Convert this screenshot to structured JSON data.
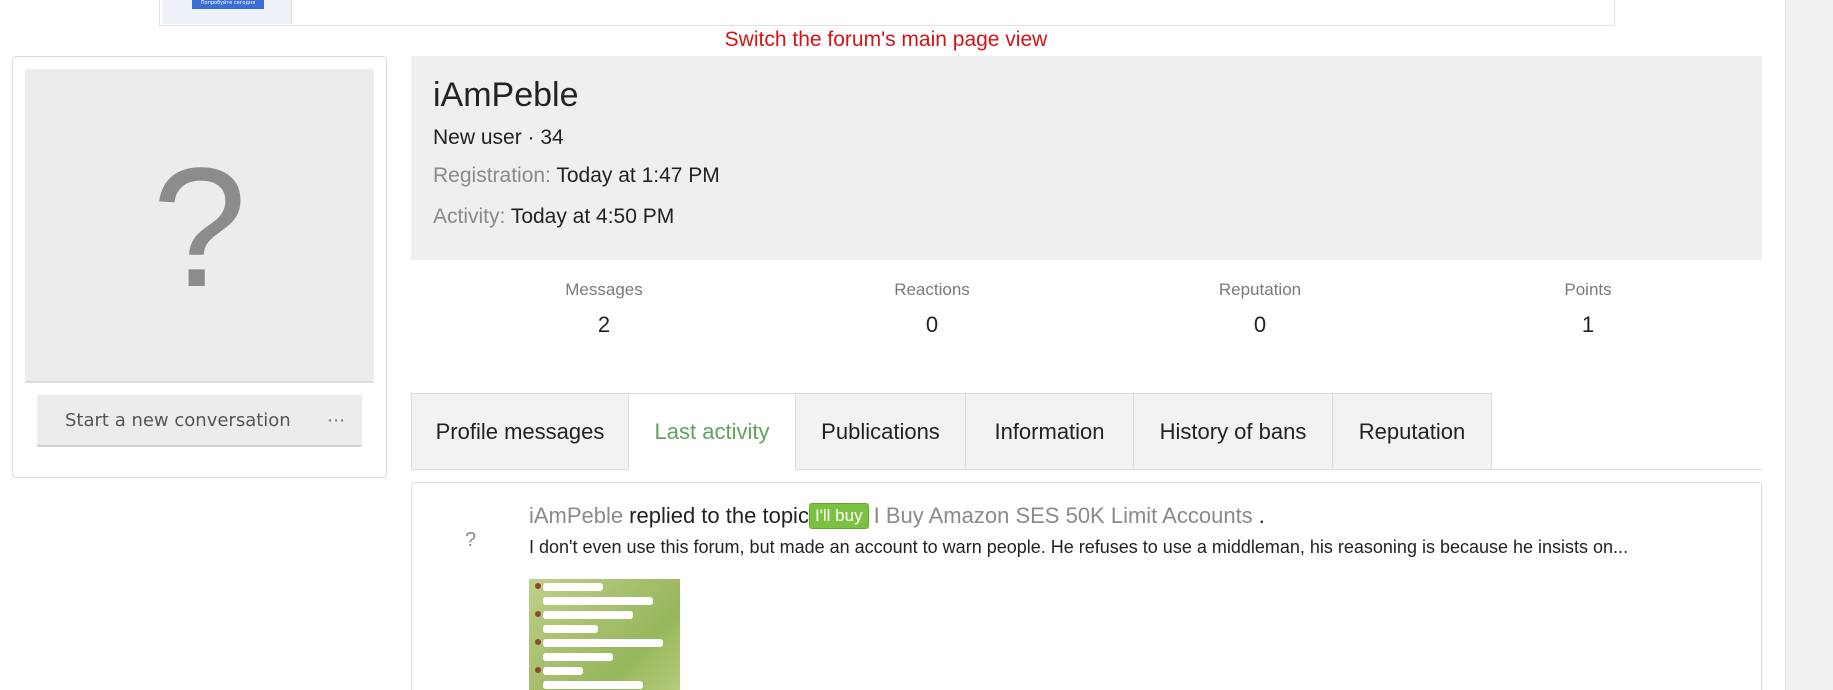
{
  "banner": {
    "ad_button": "Попробуйте сегодня"
  },
  "switch_view": "Switch the forum's main page view",
  "sidebar": {
    "avatar_placeholder": "?",
    "conversation_button": "Start a new conversation",
    "more_button": "⋯"
  },
  "profile": {
    "username": "iAmPeble",
    "user_title": "New user · 34",
    "registration_label": "Registration:",
    "registration_value": "Today at 1:47 PM",
    "activity_label": "Activity:",
    "activity_value": "Today at 4:50 PM"
  },
  "stats": [
    {
      "label": "Messages",
      "value": "2"
    },
    {
      "label": "Reactions",
      "value": "0"
    },
    {
      "label": "Reputation",
      "value": "0"
    },
    {
      "label": "Points",
      "value": "1"
    }
  ],
  "tabs": [
    {
      "label": "Profile messages",
      "active": false
    },
    {
      "label": "Last activity",
      "active": true
    },
    {
      "label": "Publications",
      "active": false
    },
    {
      "label": "Information",
      "active": false
    },
    {
      "label": "History of bans",
      "active": false
    },
    {
      "label": "Reputation",
      "active": false
    }
  ],
  "activity_item": {
    "avatar": "?",
    "user": "iAmPeble",
    "action": "replied to the topic",
    "prefix_badge": "I'll buy",
    "thread_title": "I Buy Amazon SES 50K Limit Accounts",
    "period": ".",
    "snippet": "I don't even use this forum, but made an account to warn people. He refuses to use a middleman, his reasoning is because he insists on..."
  },
  "colors": {
    "accent_green": "#5ea35e",
    "badge_green": "#7cc242",
    "link_red": "#d21414"
  }
}
